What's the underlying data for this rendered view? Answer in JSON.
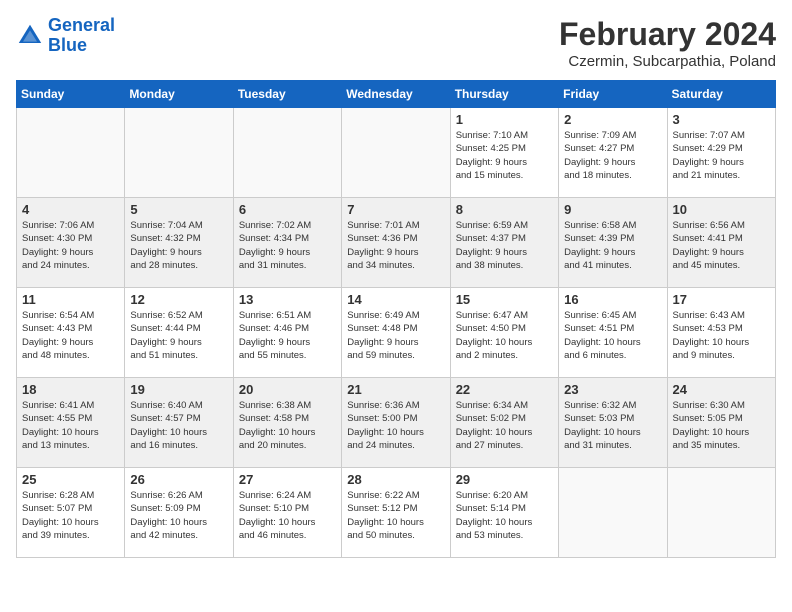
{
  "logo": {
    "line1": "General",
    "line2": "Blue"
  },
  "header": {
    "month": "February 2024",
    "location": "Czermin, Subcarpathia, Poland"
  },
  "weekdays": [
    "Sunday",
    "Monday",
    "Tuesday",
    "Wednesday",
    "Thursday",
    "Friday",
    "Saturday"
  ],
  "weeks": [
    [
      {
        "day": "",
        "info": ""
      },
      {
        "day": "",
        "info": ""
      },
      {
        "day": "",
        "info": ""
      },
      {
        "day": "",
        "info": ""
      },
      {
        "day": "1",
        "info": "Sunrise: 7:10 AM\nSunset: 4:25 PM\nDaylight: 9 hours\nand 15 minutes."
      },
      {
        "day": "2",
        "info": "Sunrise: 7:09 AM\nSunset: 4:27 PM\nDaylight: 9 hours\nand 18 minutes."
      },
      {
        "day": "3",
        "info": "Sunrise: 7:07 AM\nSunset: 4:29 PM\nDaylight: 9 hours\nand 21 minutes."
      }
    ],
    [
      {
        "day": "4",
        "info": "Sunrise: 7:06 AM\nSunset: 4:30 PM\nDaylight: 9 hours\nand 24 minutes."
      },
      {
        "day": "5",
        "info": "Sunrise: 7:04 AM\nSunset: 4:32 PM\nDaylight: 9 hours\nand 28 minutes."
      },
      {
        "day": "6",
        "info": "Sunrise: 7:02 AM\nSunset: 4:34 PM\nDaylight: 9 hours\nand 31 minutes."
      },
      {
        "day": "7",
        "info": "Sunrise: 7:01 AM\nSunset: 4:36 PM\nDaylight: 9 hours\nand 34 minutes."
      },
      {
        "day": "8",
        "info": "Sunrise: 6:59 AM\nSunset: 4:37 PM\nDaylight: 9 hours\nand 38 minutes."
      },
      {
        "day": "9",
        "info": "Sunrise: 6:58 AM\nSunset: 4:39 PM\nDaylight: 9 hours\nand 41 minutes."
      },
      {
        "day": "10",
        "info": "Sunrise: 6:56 AM\nSunset: 4:41 PM\nDaylight: 9 hours\nand 45 minutes."
      }
    ],
    [
      {
        "day": "11",
        "info": "Sunrise: 6:54 AM\nSunset: 4:43 PM\nDaylight: 9 hours\nand 48 minutes."
      },
      {
        "day": "12",
        "info": "Sunrise: 6:52 AM\nSunset: 4:44 PM\nDaylight: 9 hours\nand 51 minutes."
      },
      {
        "day": "13",
        "info": "Sunrise: 6:51 AM\nSunset: 4:46 PM\nDaylight: 9 hours\nand 55 minutes."
      },
      {
        "day": "14",
        "info": "Sunrise: 6:49 AM\nSunset: 4:48 PM\nDaylight: 9 hours\nand 59 minutes."
      },
      {
        "day": "15",
        "info": "Sunrise: 6:47 AM\nSunset: 4:50 PM\nDaylight: 10 hours\nand 2 minutes."
      },
      {
        "day": "16",
        "info": "Sunrise: 6:45 AM\nSunset: 4:51 PM\nDaylight: 10 hours\nand 6 minutes."
      },
      {
        "day": "17",
        "info": "Sunrise: 6:43 AM\nSunset: 4:53 PM\nDaylight: 10 hours\nand 9 minutes."
      }
    ],
    [
      {
        "day": "18",
        "info": "Sunrise: 6:41 AM\nSunset: 4:55 PM\nDaylight: 10 hours\nand 13 minutes."
      },
      {
        "day": "19",
        "info": "Sunrise: 6:40 AM\nSunset: 4:57 PM\nDaylight: 10 hours\nand 16 minutes."
      },
      {
        "day": "20",
        "info": "Sunrise: 6:38 AM\nSunset: 4:58 PM\nDaylight: 10 hours\nand 20 minutes."
      },
      {
        "day": "21",
        "info": "Sunrise: 6:36 AM\nSunset: 5:00 PM\nDaylight: 10 hours\nand 24 minutes."
      },
      {
        "day": "22",
        "info": "Sunrise: 6:34 AM\nSunset: 5:02 PM\nDaylight: 10 hours\nand 27 minutes."
      },
      {
        "day": "23",
        "info": "Sunrise: 6:32 AM\nSunset: 5:03 PM\nDaylight: 10 hours\nand 31 minutes."
      },
      {
        "day": "24",
        "info": "Sunrise: 6:30 AM\nSunset: 5:05 PM\nDaylight: 10 hours\nand 35 minutes."
      }
    ],
    [
      {
        "day": "25",
        "info": "Sunrise: 6:28 AM\nSunset: 5:07 PM\nDaylight: 10 hours\nand 39 minutes."
      },
      {
        "day": "26",
        "info": "Sunrise: 6:26 AM\nSunset: 5:09 PM\nDaylight: 10 hours\nand 42 minutes."
      },
      {
        "day": "27",
        "info": "Sunrise: 6:24 AM\nSunset: 5:10 PM\nDaylight: 10 hours\nand 46 minutes."
      },
      {
        "day": "28",
        "info": "Sunrise: 6:22 AM\nSunset: 5:12 PM\nDaylight: 10 hours\nand 50 minutes."
      },
      {
        "day": "29",
        "info": "Sunrise: 6:20 AM\nSunset: 5:14 PM\nDaylight: 10 hours\nand 53 minutes."
      },
      {
        "day": "",
        "info": ""
      },
      {
        "day": "",
        "info": ""
      }
    ]
  ]
}
